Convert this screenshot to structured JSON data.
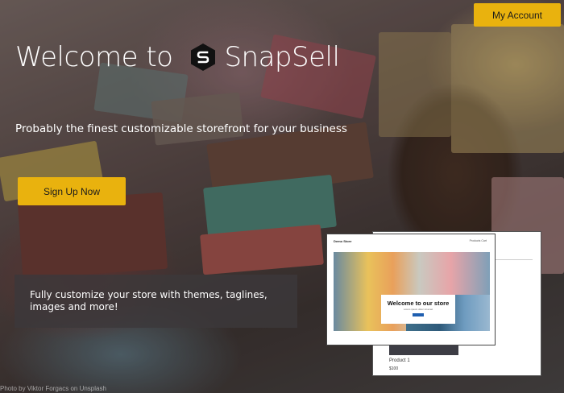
{
  "header": {
    "account_label": "My Account"
  },
  "hero": {
    "welcome_text": "Welcome to",
    "brand_name": "SnapSell",
    "tagline": "Probably the finest customizable storefront for your business",
    "signup_label": "Sign Up Now"
  },
  "feature": {
    "text": "Fully customize your store with themes, taglines, images and more!"
  },
  "preview": {
    "store_name": "Demo Store",
    "nav_text": "Products  Cart",
    "hero_heading": "Welcome to our store",
    "hero_subtext": "Lorem ipsum dolor sit amet",
    "product_name": "Product 1",
    "product_price": "$100"
  },
  "credit": {
    "text": "Photo by Viktor Forgacs on Unsplash"
  },
  "colors": {
    "accent": "#e9b20e",
    "button_text": "#1b1b1b"
  },
  "icons": {
    "brand_logo": "snapsell-logo-icon"
  }
}
